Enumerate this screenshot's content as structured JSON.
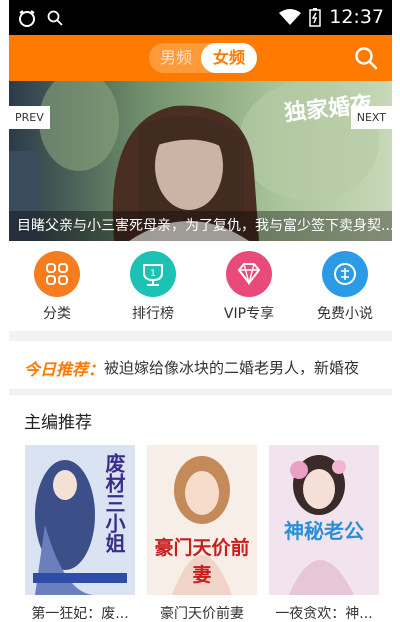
{
  "status": {
    "time": "12:37"
  },
  "header": {
    "tab_male": "男频",
    "tab_female": "女频"
  },
  "banner": {
    "prev_label": "PREV",
    "next_label": "NEXT",
    "calligraphy": "独家婚夜",
    "caption": "目睹父亲与小三害死母亲，为了复仇，我与富少签下卖身契..."
  },
  "categories": [
    {
      "label": "分类",
      "icon": "grid-icon",
      "color": "#f57c1f"
    },
    {
      "label": "排行榜",
      "icon": "trophy-icon",
      "color": "#1cc2b3"
    },
    {
      "label": "VIP专享",
      "icon": "diamond-icon",
      "color": "#e84a7a"
    },
    {
      "label": "免费小说",
      "icon": "free-badge-icon",
      "color": "#2c9be6"
    }
  ],
  "today": {
    "tag": "今日推荐：",
    "text": "被迫嫁给像冰块的二婚老男人，新婚夜"
  },
  "editor": {
    "title": "主编推荐",
    "books": [
      {
        "title": "第一狂妃：废...",
        "cover_text": "废材三小姐"
      },
      {
        "title": "豪门天价前妻",
        "cover_text": "豪门天价前妻"
      },
      {
        "title": "一夜贪欢：神...",
        "cover_text": "神秘老公"
      }
    ]
  }
}
